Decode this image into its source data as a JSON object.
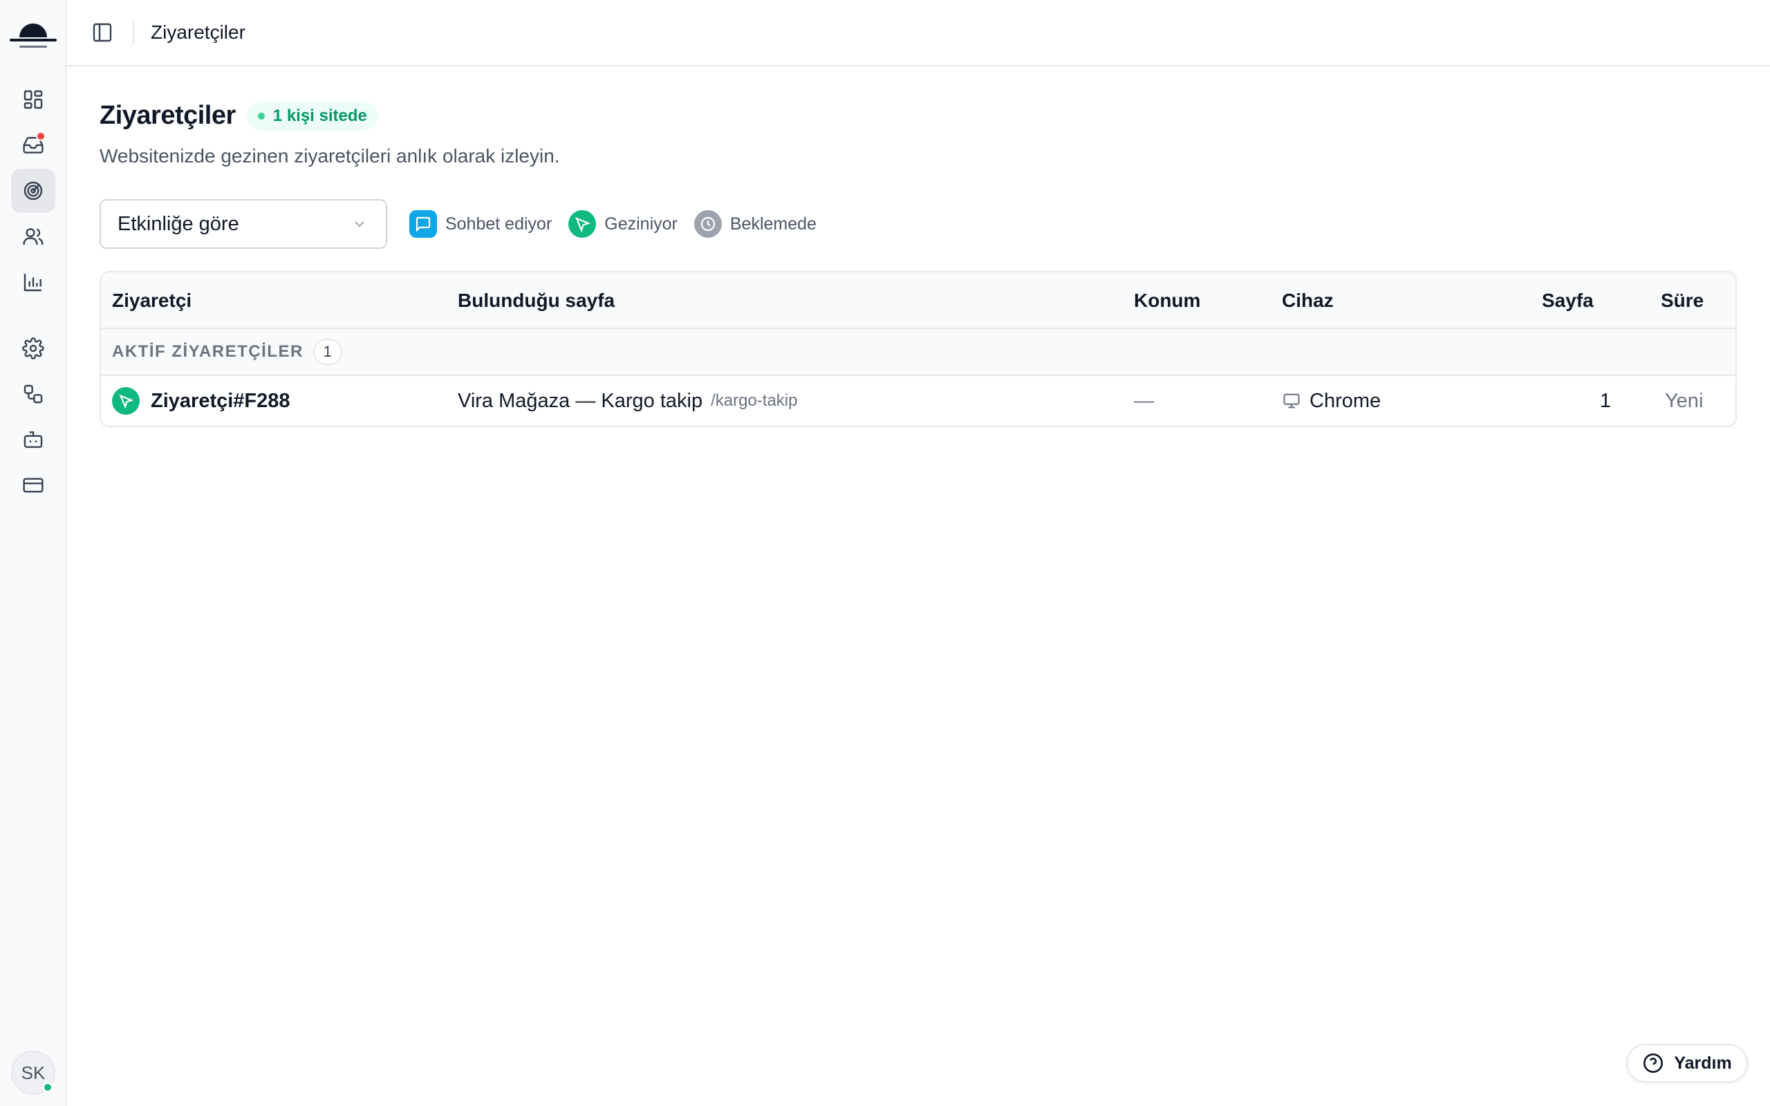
{
  "sidebar": {
    "nav": [
      {
        "name": "dashboard",
        "icon": "grid-icon"
      },
      {
        "name": "inbox",
        "icon": "inbox-icon",
        "has_notification": true
      },
      {
        "name": "visitors",
        "icon": "radar-icon",
        "active": true
      },
      {
        "name": "contacts",
        "icon": "users-icon"
      },
      {
        "name": "analytics",
        "icon": "bar-chart-icon"
      },
      {
        "name": "settings",
        "icon": "gear-icon"
      },
      {
        "name": "integrations",
        "icon": "workflow-icon"
      },
      {
        "name": "bot",
        "icon": "bot-icon"
      },
      {
        "name": "billing",
        "icon": "credit-card-icon"
      }
    ],
    "avatar_initials": "SK"
  },
  "topbar": {
    "breadcrumb": "Ziyaretçiler"
  },
  "page": {
    "title": "Ziyaretçiler",
    "live_badge": "1 kişi sitede",
    "subtitle": "Websitenizde gezinen ziyaretçileri anlık olarak izleyin."
  },
  "filters": {
    "sort_select": "Etkinliğe göre",
    "legend": [
      {
        "label": "Sohbet ediyor",
        "color": "#0ea5e9",
        "icon": "message-square-icon"
      },
      {
        "label": "Geziniyor",
        "color": "#10b981",
        "icon": "cursor-icon"
      },
      {
        "label": "Beklemede",
        "color": "#9ca3af",
        "icon": "clock-icon"
      }
    ]
  },
  "table": {
    "columns": [
      "Ziyaretçi",
      "Bulunduğu sayfa",
      "Konum",
      "Cihaz",
      "Sayfa",
      "Süre"
    ],
    "group": {
      "label": "AKTİF ZİYARETÇİLER",
      "count": "1"
    },
    "rows": [
      {
        "visitor": "Ziyaretçi#F288",
        "page_title": "Vira Mağaza — Kargo takip",
        "page_path": "/kargo-takip",
        "location": "—",
        "device": "Chrome",
        "pages": "1",
        "duration": "Yeni"
      }
    ]
  },
  "help": {
    "label": "Yardım"
  }
}
